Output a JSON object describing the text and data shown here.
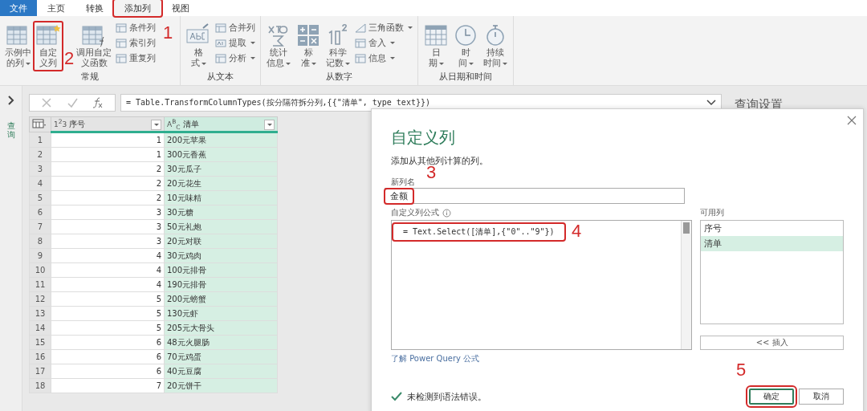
{
  "menu_tabs": [
    {
      "label": "文件",
      "kind": "file",
      "selected": false
    },
    {
      "label": "主页",
      "kind": "tab",
      "selected": false
    },
    {
      "label": "转换",
      "kind": "tab",
      "selected": false
    },
    {
      "label": "添加列",
      "kind": "tab",
      "selected": true,
      "annotation": "1"
    },
    {
      "label": "视图",
      "kind": "tab",
      "selected": false
    }
  ],
  "ribbon_groups": [
    {
      "label": "常规",
      "large": [
        {
          "lines": [
            "示例中",
            "的列"
          ],
          "dropdown": true
        },
        {
          "lines": [
            "自定",
            "义列"
          ],
          "dropdown": false,
          "annotation": "2"
        },
        {
          "lines": [
            "调用自定",
            "义函数"
          ],
          "dropdown": false
        }
      ],
      "small": [
        {
          "label": "条件列",
          "dropdown": false
        },
        {
          "label": "索引列",
          "dropdown": false
        },
        {
          "label": "重复列",
          "dropdown": false
        }
      ]
    },
    {
      "label": "从文本",
      "large": [
        {
          "lines": [
            "格",
            "式"
          ],
          "dropdown": true
        }
      ],
      "small": [
        {
          "label": "合并列",
          "dropdown": false
        },
        {
          "label": "提取",
          "dropdown": true
        },
        {
          "label": "分析",
          "dropdown": true
        }
      ]
    },
    {
      "label": "从数字",
      "large": [
        {
          "lines": [
            "统计",
            "信息"
          ],
          "dropdown": true
        },
        {
          "lines": [
            "标",
            "准"
          ],
          "dropdown": true
        },
        {
          "lines": [
            "科学",
            "记数"
          ],
          "dropdown": true
        }
      ],
      "small": [
        {
          "label": "三角函数",
          "dropdown": true
        },
        {
          "label": "舍入",
          "dropdown": true
        },
        {
          "label": "信息",
          "dropdown": true
        }
      ]
    },
    {
      "label": "从日期和时间",
      "large": [
        {
          "lines": [
            "日",
            "期"
          ],
          "dropdown": true
        },
        {
          "lines": [
            "时",
            "间"
          ],
          "dropdown": true
        },
        {
          "lines": [
            "持续",
            "时间"
          ],
          "dropdown": true
        }
      ]
    }
  ],
  "queries_pane": {
    "label": "查询"
  },
  "formula_bar": {
    "formula": "= Table.TransformColumnTypes(按分隔符拆分列,{{\"清单\", type text}})"
  },
  "query_settings": {
    "title": "查询设置"
  },
  "table": {
    "columns": [
      {
        "kind": "index"
      },
      {
        "type_label": "1$^{2}$3",
        "name": "序号",
        "selected": false
      },
      {
        "type_label": "A$^{B}$$_{C}$",
        "name": "清单",
        "selected": true
      }
    ],
    "rows": [
      [
        "1",
        "1",
        "200元苹果"
      ],
      [
        "2",
        "1",
        "300元香蕉"
      ],
      [
        "3",
        "2",
        "30元瓜子"
      ],
      [
        "4",
        "2",
        "20元花生"
      ],
      [
        "5",
        "2",
        "10元味精"
      ],
      [
        "6",
        "3",
        "30元糖"
      ],
      [
        "7",
        "3",
        "50元礼炮"
      ],
      [
        "8",
        "3",
        "20元对联"
      ],
      [
        "9",
        "4",
        "30元鸡肉"
      ],
      [
        "10",
        "4",
        "100元排骨"
      ],
      [
        "11",
        "4",
        "190元排骨"
      ],
      [
        "12",
        "5",
        "200元螃蟹"
      ],
      [
        "13",
        "5",
        "130元虾"
      ],
      [
        "14",
        "5",
        "205元大骨头"
      ],
      [
        "15",
        "6",
        "48元火腿肠"
      ],
      [
        "16",
        "6",
        "70元鸡蛋"
      ],
      [
        "17",
        "6",
        "40元豆腐"
      ],
      [
        "18",
        "7",
        "20元饼干"
      ]
    ]
  },
  "dialog": {
    "title": "自定义列",
    "subtitle": "添加从其他列计算的列。",
    "name_label": "新列名",
    "name_value": "金额",
    "name_annotation": "3",
    "formula_label": "自定义列公式",
    "formula": "= Text.Select([清单],{\"0\"..\"9\"})",
    "formula_annotation": "4",
    "available_label": "可用列",
    "available": [
      {
        "label": "序号",
        "selected": false
      },
      {
        "label": "清单",
        "selected": true
      }
    ],
    "insert_button": "<< 插入",
    "link": "了解 Power Query 公式",
    "status": "未检测到语法错误。",
    "buttons": [
      {
        "label": "确定",
        "kind": "primary",
        "annotation": "5"
      },
      {
        "label": "取消",
        "kind": "secondary"
      }
    ]
  }
}
